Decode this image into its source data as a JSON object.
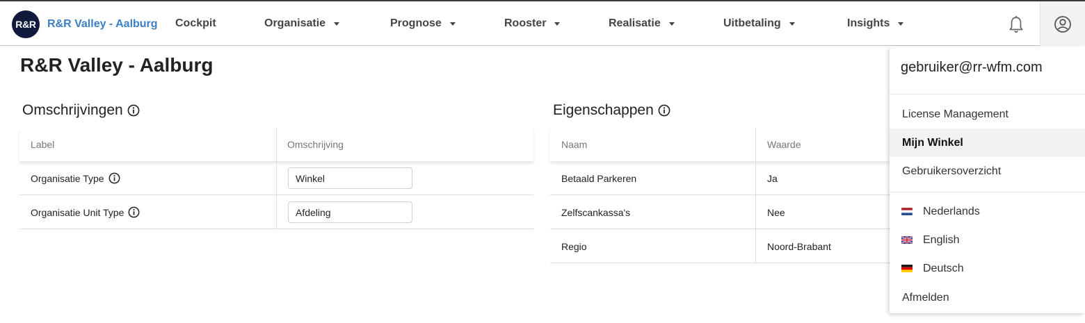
{
  "app": {
    "logo_text": "R&R",
    "brand": "R&R Valley - Aalburg"
  },
  "nav": {
    "cockpit": "Cockpit",
    "organisatie": "Organisatie",
    "prognose": "Prognose",
    "rooster": "Rooster",
    "realisatie": "Realisatie",
    "uitbetaling": "Uitbetaling",
    "insights": "Insights"
  },
  "page": {
    "title": "R&R Valley - Aalburg"
  },
  "omschrijvingen": {
    "title": "Omschrijvingen",
    "headers": [
      "Label",
      "Omschrijving"
    ],
    "rows": [
      {
        "label": "Organisatie Type",
        "value": "Winkel"
      },
      {
        "label": "Organisatie Unit Type",
        "value": "Afdeling"
      }
    ]
  },
  "eigenschappen": {
    "title": "Eigenschappen",
    "headers": [
      "Naam",
      "Waarde"
    ],
    "rows": [
      {
        "name": "Betaald Parkeren",
        "value": "Ja"
      },
      {
        "name": "Zelfscankassa's",
        "value": "Nee"
      },
      {
        "name": "Regio",
        "value": "Noord-Brabant"
      }
    ]
  },
  "user_menu": {
    "email": "gebruiker@rr-wfm.com",
    "items": [
      "License Management",
      "Mijn Winkel",
      "Gebruikersoverzicht"
    ],
    "active_item": "Mijn Winkel",
    "languages": [
      "Nederlands",
      "English",
      "Deutsch"
    ],
    "logout": "Afmelden"
  },
  "colors": {
    "brand_blue": "#3b7fc4",
    "logo_bg": "#0f1a3c"
  },
  "icons": {
    "bell": "bell-icon",
    "user": "user-circle-icon",
    "info": "info-icon",
    "caret": "caret-down-icon"
  }
}
